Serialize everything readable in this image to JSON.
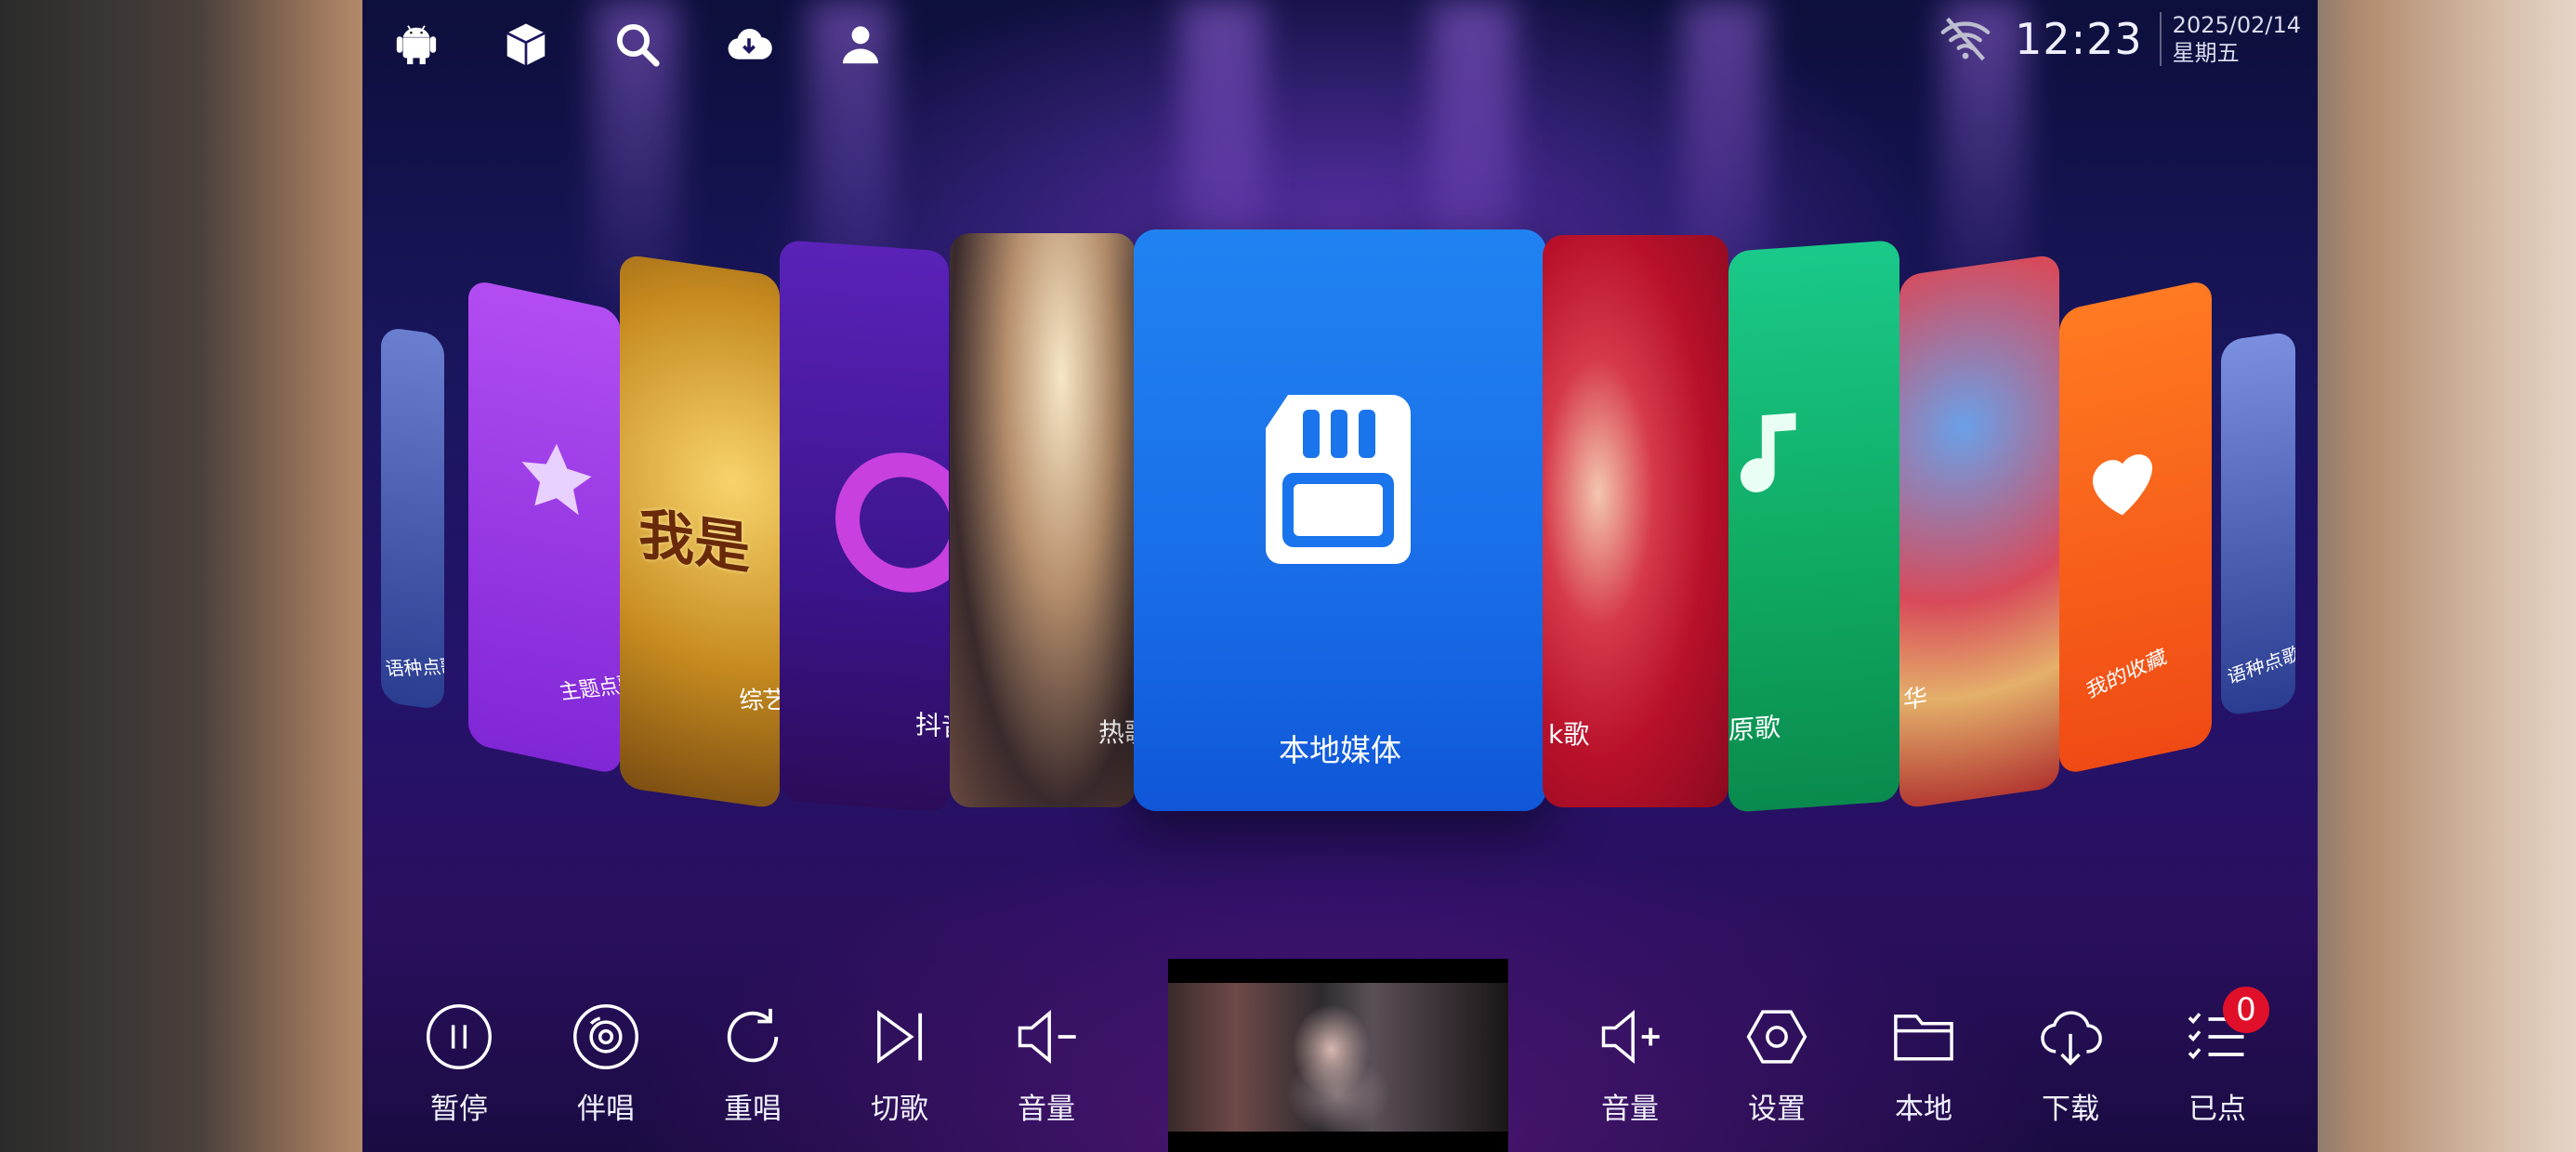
{
  "topbar": {
    "icons": [
      "android-icon",
      "package-icon",
      "search-icon",
      "cloud-download-icon",
      "user-icon"
    ],
    "time": "12:23",
    "date": "2025/02/14",
    "weekday": "星期五"
  },
  "carousel": {
    "selected": "本地媒体",
    "cards": [
      {
        "label": "语种点歌",
        "bg": "#3a5bb8"
      },
      {
        "label": "主题点歌",
        "bg": "#9b37e8"
      },
      {
        "label": "综艺",
        "bg": "#d59a2a"
      },
      {
        "label": "抖音",
        "bg": "#4a1f9e"
      },
      {
        "label": "热歌",
        "bg": "#8a6a50"
      },
      {
        "label": "本地媒体",
        "bg": "#1a74ec"
      },
      {
        "label": "k歌",
        "bg": "#c8102e"
      },
      {
        "label": "原歌",
        "bg": "#12b56a"
      },
      {
        "label": "华",
        "bg": "#d8363f"
      },
      {
        "label": "我的收藏",
        "bg": "#f25a18"
      },
      {
        "label": "语种点歌",
        "bg": "#3a5bb8"
      }
    ]
  },
  "controls": {
    "left": [
      {
        "label": "暂停",
        "icon": "pause-icon"
      },
      {
        "label": "伴唱",
        "icon": "disc-icon"
      },
      {
        "label": "重唱",
        "icon": "replay-icon"
      },
      {
        "label": "切歌",
        "icon": "skip-next-icon"
      },
      {
        "label": "音量",
        "icon": "volume-down-icon"
      }
    ],
    "right": [
      {
        "label": "音量",
        "icon": "volume-up-icon"
      },
      {
        "label": "设置",
        "icon": "settings-icon"
      },
      {
        "label": "本地",
        "icon": "folder-icon"
      },
      {
        "label": "下载",
        "icon": "cloud-download-icon"
      },
      {
        "label": "已点",
        "icon": "playlist-icon"
      }
    ],
    "queue_count": "0"
  },
  "colors": {
    "accent": "#1a74ec",
    "badge": "#e0102a"
  }
}
